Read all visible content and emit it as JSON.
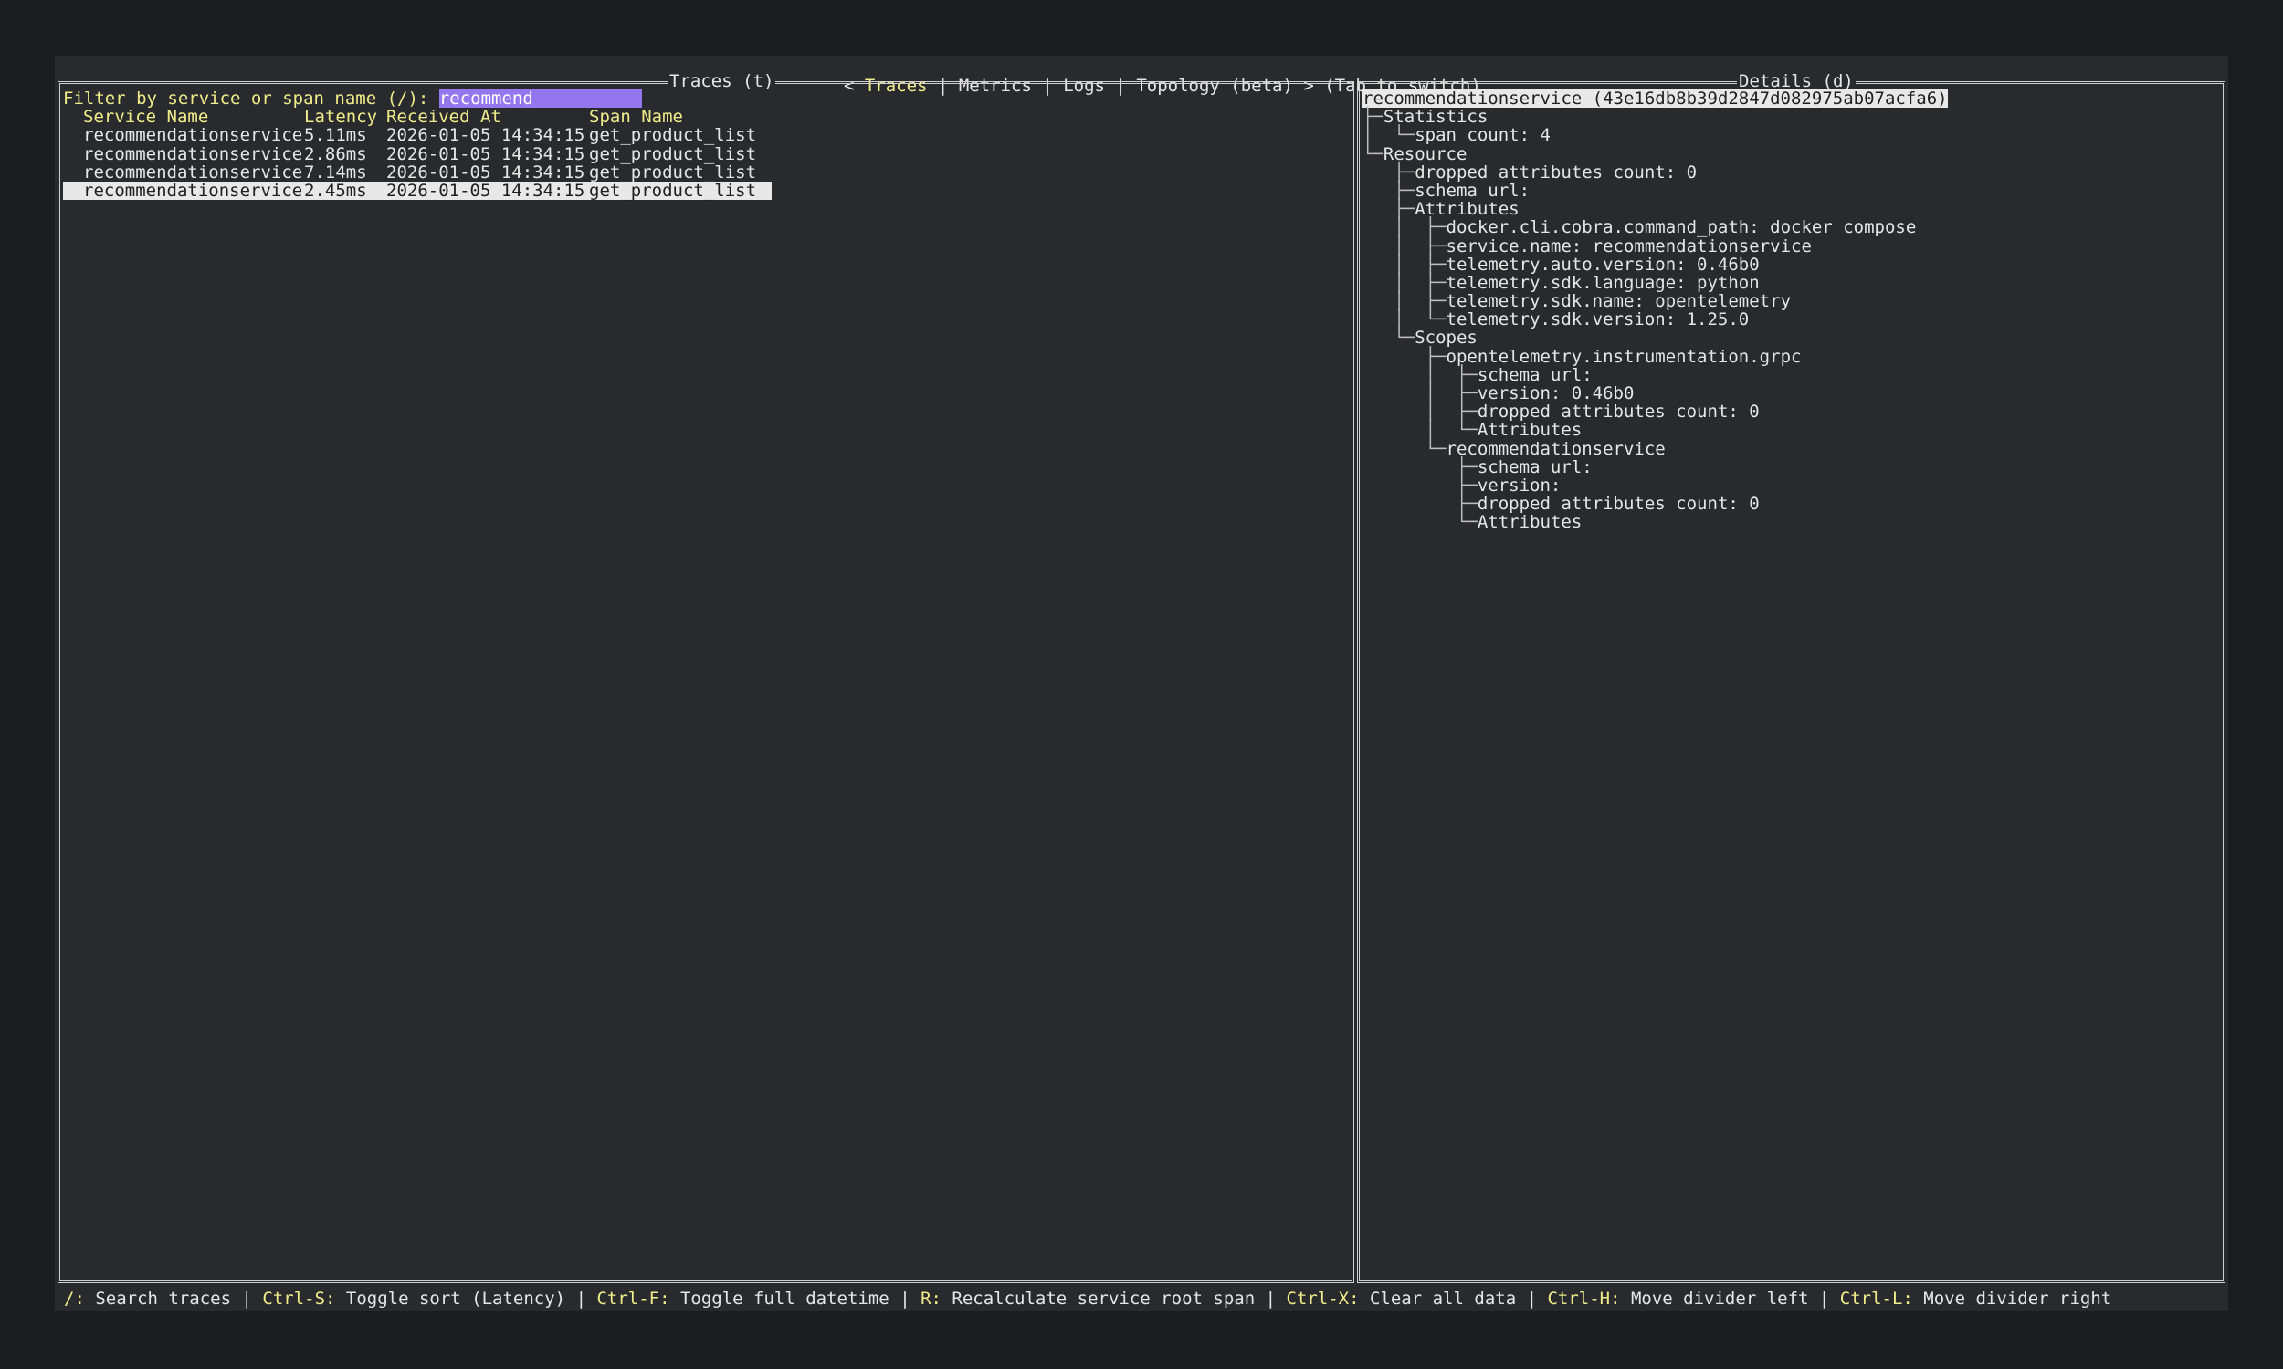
{
  "tabbar": {
    "prefix": "< ",
    "tabs": [
      "Traces",
      "Metrics",
      "Logs",
      "Topology (beta)"
    ],
    "separator": " | ",
    "suffix": " > (Tab to switch)"
  },
  "traces_pane": {
    "title": "Traces (t)",
    "filter_label": "Filter by service or span name (/):",
    "filter_value": "recommend",
    "columns": [
      "Service Name",
      "Latency",
      "Received At",
      "Span Name"
    ],
    "rows": [
      {
        "service": "recommendationservice",
        "latency": "5.11ms",
        "received": "2026-01-05 14:34:15",
        "span": "get_product_list"
      },
      {
        "service": "recommendationservice",
        "latency": "2.86ms",
        "received": "2026-01-05 14:34:15",
        "span": "get_product_list"
      },
      {
        "service": "recommendationservice",
        "latency": "7.14ms",
        "received": "2026-01-05 14:34:15",
        "span": "get_product_list"
      },
      {
        "service": "recommendationservice",
        "latency": "2.45ms",
        "received": "2026-01-05 14:34:15",
        "span": "get_product_list"
      }
    ],
    "selected_row": 3
  },
  "details_pane": {
    "title": "Details (d)",
    "trace_title": "recommendationservice (43e16db8b39d2847d082975ab07acfa6)",
    "tree": [
      {
        "prefix": "├─",
        "text": "Statistics"
      },
      {
        "prefix": "│  └─",
        "text": "span count: 4"
      },
      {
        "prefix": "└─",
        "text": "Resource"
      },
      {
        "prefix": "   ├─",
        "text": "dropped attributes count: 0"
      },
      {
        "prefix": "   ├─",
        "text": "schema url:"
      },
      {
        "prefix": "   ├─",
        "text": "Attributes"
      },
      {
        "prefix": "   │  ├─",
        "text": "docker.cli.cobra.command_path: docker compose"
      },
      {
        "prefix": "   │  ├─",
        "text": "service.name: recommendationservice"
      },
      {
        "prefix": "   │  ├─",
        "text": "telemetry.auto.version: 0.46b0"
      },
      {
        "prefix": "   │  ├─",
        "text": "telemetry.sdk.language: python"
      },
      {
        "prefix": "   │  ├─",
        "text": "telemetry.sdk.name: opentelemetry"
      },
      {
        "prefix": "   │  └─",
        "text": "telemetry.sdk.version: 1.25.0"
      },
      {
        "prefix": "   └─",
        "text": "Scopes"
      },
      {
        "prefix": "      ├─",
        "text": "opentelemetry.instrumentation.grpc"
      },
      {
        "prefix": "      │  ├─",
        "text": "schema url:"
      },
      {
        "prefix": "      │  ├─",
        "text": "version: 0.46b0"
      },
      {
        "prefix": "      │  ├─",
        "text": "dropped attributes count: 0"
      },
      {
        "prefix": "      │  └─",
        "text": "Attributes"
      },
      {
        "prefix": "      └─",
        "text": "recommendationservice"
      },
      {
        "prefix": "         ├─",
        "text": "schema url:"
      },
      {
        "prefix": "         ├─",
        "text": "version:"
      },
      {
        "prefix": "         ├─",
        "text": "dropped attributes count: 0"
      },
      {
        "prefix": "         └─",
        "text": "Attributes"
      }
    ]
  },
  "footer": {
    "items": [
      {
        "key": "/:",
        "desc": " Search traces"
      },
      {
        "key": "Ctrl-S:",
        "desc": " Toggle sort (Latency)"
      },
      {
        "key": "Ctrl-F:",
        "desc": " Toggle full datetime"
      },
      {
        "key": "R:",
        "desc": " Recalculate service root span"
      },
      {
        "key": "Ctrl-X:",
        "desc": " Clear all data"
      },
      {
        "key": "Ctrl-H:",
        "desc": " Move divider left"
      },
      {
        "key": "Ctrl-L:",
        "desc": " Move divider right"
      }
    ],
    "separator": " | "
  },
  "colors": {
    "background": "#1b1c1e",
    "terminal": "#292a2e",
    "accent": "#f0ec8a",
    "filter_highlight": "#9476ee",
    "selection": "#e8e8e8"
  }
}
